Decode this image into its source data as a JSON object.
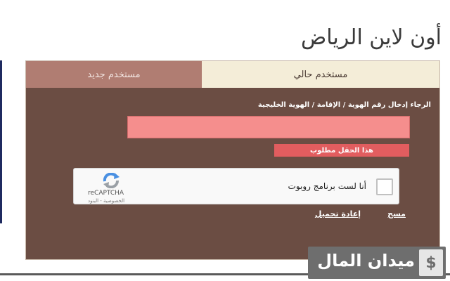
{
  "page": {
    "title": "أون لاين الرياض"
  },
  "tabs": {
    "existing": "مستخدم حالي",
    "new": "مستخدم جديد"
  },
  "form": {
    "id_label": "الرجاء إدخال رقم الهوية / الإقامة / الهوية الخليجية",
    "id_value": "",
    "error": "هذا الحقل مطلوب"
  },
  "captcha": {
    "label": "أنا لست برنامج روبوت",
    "brand": "reCAPTCHA",
    "links": "الخصوصية - البنود"
  },
  "actions": {
    "clear": "مسح",
    "reload": "إعادة تحميل"
  },
  "watermark": {
    "text": "ميدان المال",
    "icon": "$"
  },
  "colors": {
    "panel": "#6b4d43",
    "error": "#e25d5f",
    "input": "#f58e8d"
  }
}
